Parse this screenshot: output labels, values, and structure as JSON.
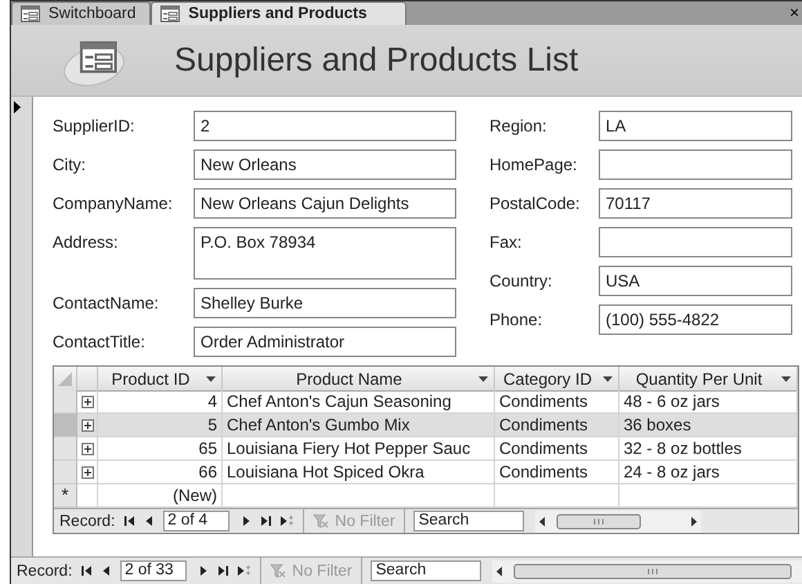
{
  "tabs": [
    {
      "label": "Switchboard",
      "selected": false
    },
    {
      "label": "Suppliers and Products",
      "selected": true
    }
  ],
  "close": "×",
  "header": {
    "title": "Suppliers and Products List"
  },
  "fields_left": [
    {
      "label": "SupplierID:",
      "value": "2",
      "kind": "line"
    },
    {
      "label": "City:",
      "value": "New Orleans",
      "kind": "line"
    },
    {
      "label": "CompanyName:",
      "value": "New Orleans Cajun Delights",
      "kind": "line"
    },
    {
      "label": "Address:",
      "value": "P.O. Box 78934",
      "kind": "box"
    },
    {
      "label": "ContactName:",
      "value": "Shelley Burke",
      "kind": "line"
    },
    {
      "label": "ContactTitle:",
      "value": "Order Administrator",
      "kind": "line"
    }
  ],
  "fields_right": [
    {
      "label": "Region:",
      "value": "LA"
    },
    {
      "label": "HomePage:"
    },
    {
      "label": "PostalCode:",
      "value": "70117"
    },
    {
      "label": "Fax:"
    },
    {
      "label": "Country:",
      "value": "USA"
    },
    {
      "label": "Phone:",
      "value": "(100) 555-4822"
    }
  ],
  "subform": {
    "columns": [
      {
        "label": "Product ID"
      },
      {
        "label": "Product Name"
      },
      {
        "label": "Category ID"
      },
      {
        "label": "Quantity Per Unit"
      }
    ],
    "rows": [
      {
        "product_id": "4",
        "product_name": "Chef Anton's Cajun Seasoning",
        "category_id": "Condiments",
        "quantity": "48 - 6 oz jars",
        "selected": false
      },
      {
        "product_id": "5",
        "product_name": "Chef Anton's Gumbo Mix",
        "category_id": "Condiments",
        "quantity": "36 boxes",
        "selected": true
      },
      {
        "product_id": "65",
        "product_name": "Louisiana Fiery Hot Pepper Sauc",
        "category_id": "Condiments",
        "quantity": "32 - 8 oz bottles",
        "selected": false
      },
      {
        "product_id": "66",
        "product_name": "Louisiana Hot Spiced Okra",
        "category_id": "Condiments",
        "quantity": "24 - 8 oz jars",
        "selected": false
      }
    ],
    "new_row": {
      "marker": "*",
      "product_id": "(New)"
    },
    "nav": {
      "label": "Record:",
      "position": "2 of 4",
      "filter": "No Filter",
      "search": "Search"
    }
  },
  "nav": {
    "label": "Record:",
    "position": "2 of 33",
    "filter": "No Filter",
    "search": "Search"
  }
}
